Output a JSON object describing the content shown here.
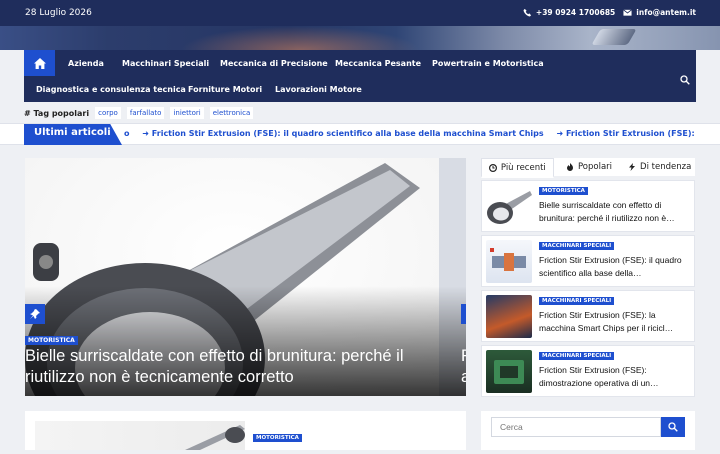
{
  "topbar": {
    "date": "28 Luglio 2026",
    "phone": "+39 0924 1700685",
    "email": "info@antem.it"
  },
  "nav": {
    "items": [
      "Azienda",
      "Macchinari Speciali",
      "Meccanica di Precisione",
      "Meccanica Pesante",
      "Powertrain e Motoristica",
      "Diagnostica e consulenza tecnica",
      "Forniture Motori",
      "Lavorazioni Motore"
    ],
    "active": "Forniture Motori"
  },
  "tags": {
    "label": "# Tag popolari",
    "items": [
      "corpo",
      "farfallato",
      "iniettori",
      "elettronica"
    ]
  },
  "ticker": {
    "head": "Ultimi articoli",
    "prefix": "o",
    "items": [
      "Friction Stir Extrusion (FSE): il quadro scientifico alla base della macchina Smart Chips",
      "Friction Stir Extrusion (FSE): la macchina Sm"
    ]
  },
  "hero": {
    "category": "MOTORISTICA",
    "title": "Bielle surriscaldate con effetto di brunitura: perché il riutilizzo non è tecnicamente corretto",
    "next_title": "F\na"
  },
  "tabs": [
    "Più recenti",
    "Popolari",
    "Di tendenza"
  ],
  "articles": [
    {
      "category": "MOTORISTICA",
      "title": "Bielle surriscaldate con effetto di brunitura: perché il riutilizzo non è…"
    },
    {
      "category": "MACCHINARI SPECIALI",
      "title": "Friction Stir Extrusion (FSE): il quadro scientifico alla base della…"
    },
    {
      "category": "MACCHINARI SPECIALI",
      "title": "Friction Stir Extrusion (FSE): la macchina Smart Chips per il ricicl…"
    },
    {
      "category": "MACCHINARI SPECIALI",
      "title": "Friction Stir Extrusion (FSE): dimostrazione operativa di un…"
    }
  ],
  "second": {
    "category": "MOTORISTICA"
  },
  "search": {
    "placeholder": "Cerca"
  }
}
